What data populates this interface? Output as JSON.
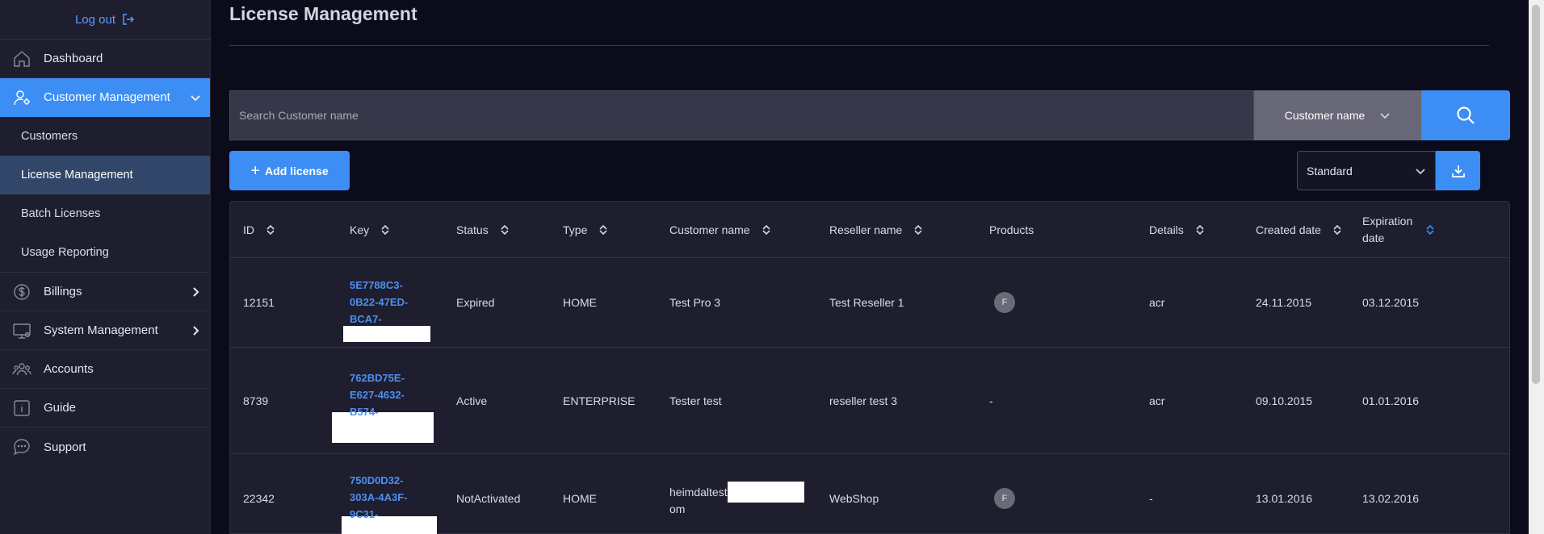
{
  "sidebar": {
    "logout_label": "Log out",
    "items": [
      {
        "label": "Dashboard",
        "icon": "home-icon"
      },
      {
        "label": "Customer Management",
        "icon": "user-gear-icon"
      },
      {
        "label": "Billings",
        "icon": "dollar-icon"
      },
      {
        "label": "System Management",
        "icon": "monitor-icon"
      },
      {
        "label": "Accounts",
        "icon": "users-icon"
      },
      {
        "label": "Guide",
        "icon": "info-icon"
      },
      {
        "label": "Support",
        "icon": "chat-icon"
      }
    ],
    "subitems": [
      {
        "label": "Customers"
      },
      {
        "label": "License Management"
      },
      {
        "label": "Batch Licenses"
      },
      {
        "label": "Usage Reporting"
      }
    ]
  },
  "page": {
    "title": "License Management"
  },
  "search": {
    "placeholder": "Search Customer name",
    "field_label": "Customer name"
  },
  "toolbar": {
    "add_label": "Add license",
    "view_label": "Standard"
  },
  "table": {
    "headers": [
      "ID",
      "Key",
      "Status",
      "Type",
      "Customer name",
      "Reseller name",
      "Products",
      "Details",
      "Created date",
      "Expiration date"
    ],
    "rows": [
      {
        "id": "12151",
        "key1": "5E7788C3-",
        "key2": "0B22-47ED-",
        "key3": "BCA7-",
        "status": "Expired",
        "type": "HOME",
        "customer": "Test Pro 3",
        "reseller": "Test Reseller 1",
        "product": "F",
        "details": "acr",
        "created": "24.11.2015",
        "expiration": "03.12.2015"
      },
      {
        "id": "8739",
        "key1": "762BD75E-",
        "key2": "E627-4632-",
        "key3": "B574-",
        "status": "Active",
        "type": "ENTERPRISE",
        "customer": "Tester test",
        "reseller": "reseller test 3",
        "product": "-",
        "details": "acr",
        "created": "09.10.2015",
        "expiration": "01.01.2016"
      },
      {
        "id": "22342",
        "key1": "750D0D32-",
        "key2": "303A-4A3F-",
        "key3": "9C31-",
        "status": "NotActivated",
        "type": "HOME",
        "customer": "heimdaltest",
        "customer2": "om",
        "reseller": "WebShop",
        "product": "F",
        "details": "-",
        "created": "13.01.2016",
        "expiration": "13.02.2016"
      }
    ]
  },
  "colors": {
    "accent": "#3c8ef5",
    "link": "#4e8fef",
    "background": "#0b0b1c",
    "sidebar": "#1e1e2f"
  }
}
